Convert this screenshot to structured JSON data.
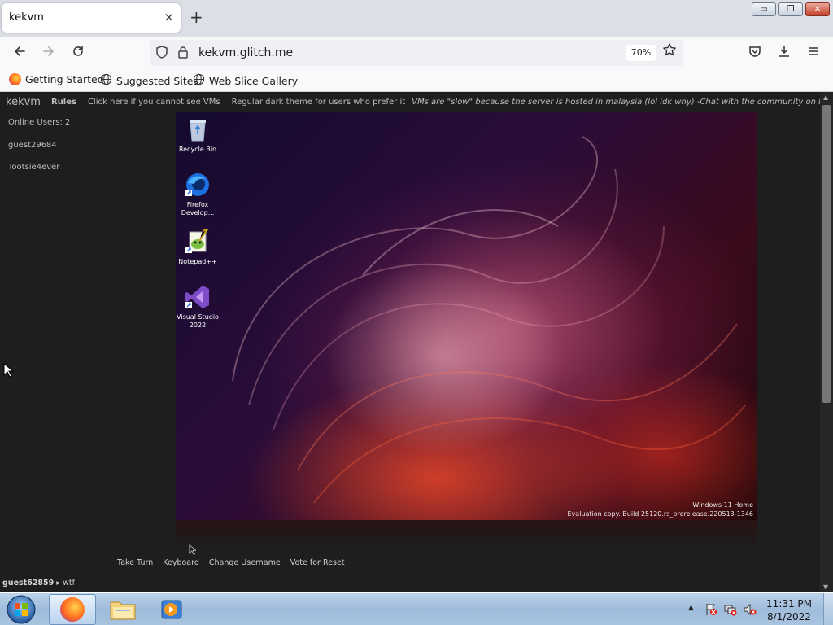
{
  "browser": {
    "tab_title": "kekvm",
    "tab_close": "×",
    "new_tab": "+",
    "window_buttons": {
      "minimize": "▭",
      "restore": "❐",
      "close": "✕"
    },
    "url": "kekvm.glitch.me",
    "zoom": "70%",
    "bookmarks": [
      "Getting Started",
      "Suggested Sites",
      "Web Slice Gallery"
    ]
  },
  "site": {
    "brand": "kekvm",
    "nav": {
      "rules": "Rules",
      "cannot_see": "Click here if you cannot see VMs",
      "theme": "Regular dark theme for users who prefer it",
      "marquee": "VMs are \"slow\" because the server is hosted in malaysia (lol idk why) -Chat with the community on IRCNet: Channel #kekvm"
    },
    "users": {
      "online": "Online Users: 2",
      "list": [
        "guest29684",
        "Tootsie4ever"
      ]
    },
    "vm": {
      "desktop_icons": [
        {
          "label": "Recycle Bin"
        },
        {
          "label": "Firefox Develop..."
        },
        {
          "label": "Notepad++"
        },
        {
          "label": "Visual Studio 2022"
        }
      ],
      "watermark_line1": "Windows 11 Home",
      "watermark_line2": "Evaluation copy. Build 25120.rs_prerelease.220513-1346"
    },
    "controls": [
      "Take Turn",
      "Keyboard",
      "Change Username",
      "Vote for Reset"
    ],
    "chat": {
      "username": "guest62859",
      "separator": "▸",
      "message": "wtf"
    }
  },
  "taskbar": {
    "time": "11:31 PM",
    "date": "8/1/2022",
    "tray_chevron": "▲"
  },
  "colors": {
    "page_bg": "#1e1e1e",
    "page_text": "#cfcfcf",
    "taskbar": "#a8c3df"
  }
}
